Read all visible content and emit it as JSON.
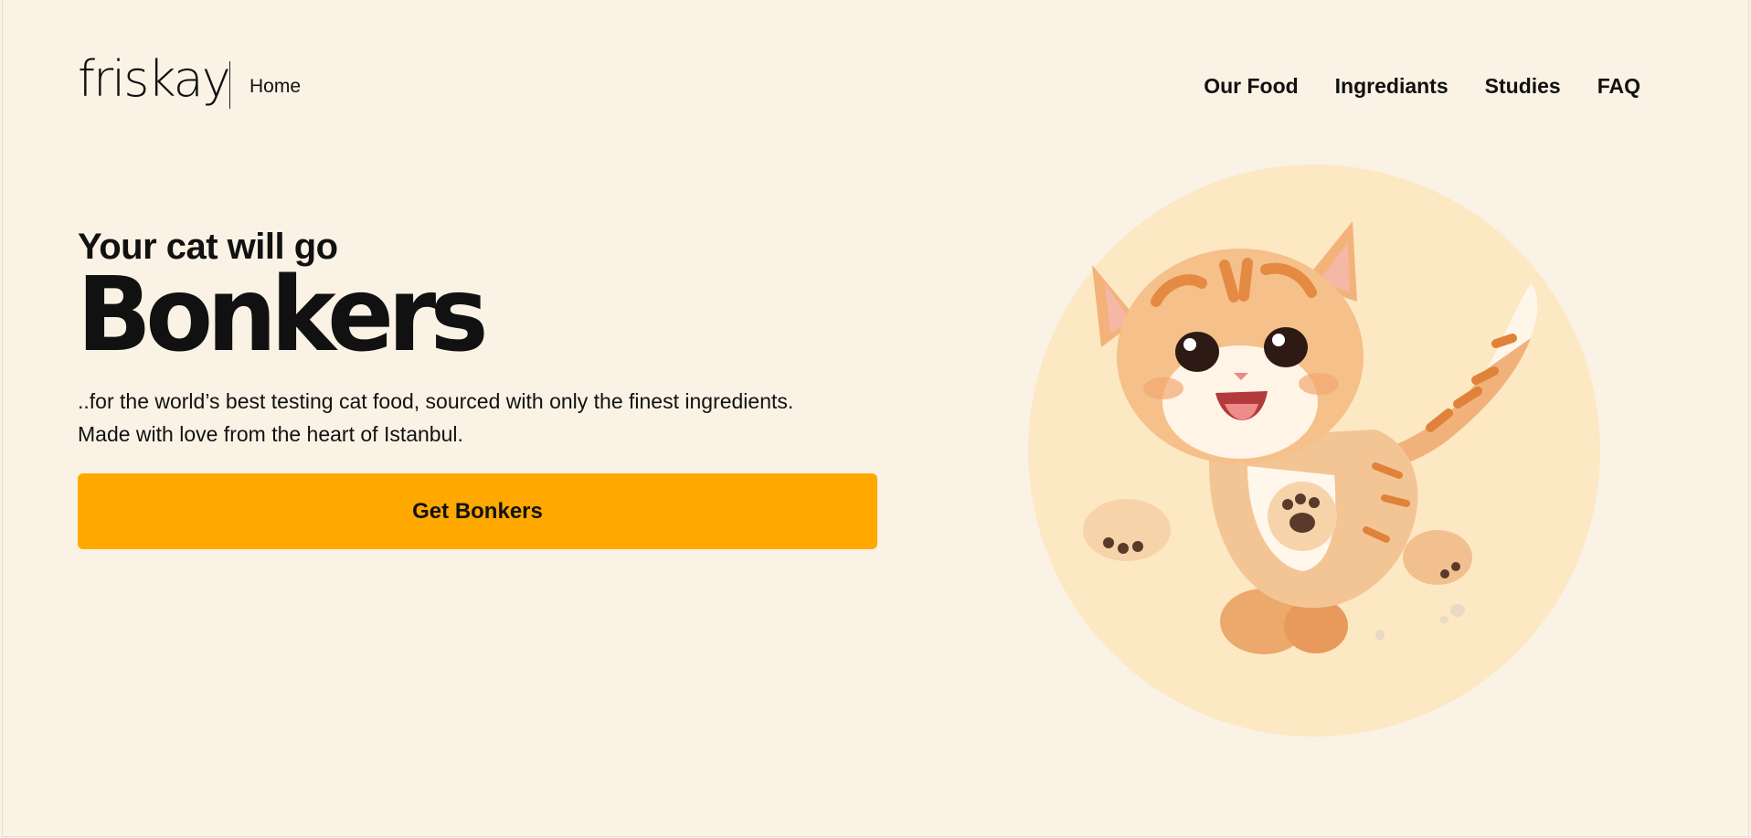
{
  "brand": {
    "logo": "friskay",
    "breadcrumb": "Home"
  },
  "nav": {
    "items": [
      "Our Food",
      "Ingrediants",
      "Studies",
      "FAQ"
    ]
  },
  "hero": {
    "kicker": "Your cat will go",
    "title": "Bonkers",
    "description_line1": "..for the world’s best testing cat food, sourced with only the finest ingredients.",
    "description_line2": "Made with love from the heart of Istanbul.",
    "cta_label": "Get Bonkers"
  },
  "illustration": {
    "subject": "jumping-kitten",
    "backdrop_color": "#fde8c4"
  },
  "colors": {
    "background": "#faf2e5",
    "accent": "#ffa800",
    "text": "#111111"
  }
}
